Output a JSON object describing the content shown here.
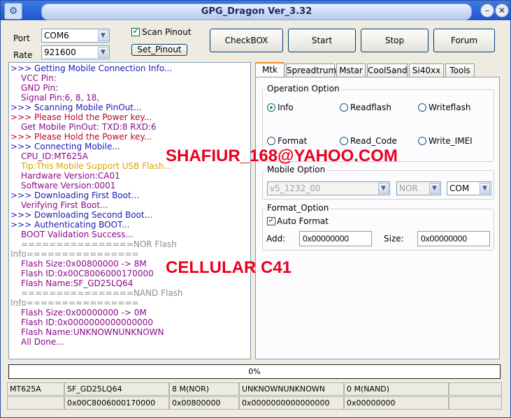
{
  "window": {
    "title": "GPG_Dragon  Ver_3.32",
    "min_glyph": "–",
    "close_glyph": "✕",
    "app_icon_glyph": "⚙"
  },
  "connection": {
    "port_label": "Port",
    "port_value": "COM6",
    "rate_label": "Rate",
    "rate_value": "921600",
    "scan_pinout_label": "Scan Pinout",
    "scan_pinout_checked": true,
    "set_pinout_label": "Set_Pinout"
  },
  "toolbar": {
    "checkbox_label": "CheckBOX",
    "start_label": "Start",
    "stop_label": "Stop",
    "forum_label": "Forum"
  },
  "log": [
    {
      "text": ">>> Getting Mobile Connection Info...",
      "color": "blue",
      "indent": 0
    },
    {
      "text": "VCC Pin:",
      "color": "purple",
      "indent": 1
    },
    {
      "text": "GND Pin:",
      "color": "purple",
      "indent": 1
    },
    {
      "text": "Signal Pin:6, 8, 18,",
      "color": "purple",
      "indent": 1
    },
    {
      "text": ">>> Scanning Mobile PinOut...",
      "color": "blue",
      "indent": 0
    },
    {
      "text": ">>> Please Hold the Power key...",
      "color": "red",
      "indent": 0
    },
    {
      "text": "Get Mobile PinOut: TXD:8  RXD:6",
      "color": "purple",
      "indent": 1
    },
    {
      "text": ">>> Please Hold the Power key...",
      "color": "red",
      "indent": 0
    },
    {
      "text": ">>> Connecting Mobile...",
      "color": "blue",
      "indent": 0
    },
    {
      "text": "CPU_ID:MT625A",
      "color": "purple",
      "indent": 1
    },
    {
      "text": "Tip:This Mobile Support USB Flash...",
      "color": "yellow",
      "indent": 1
    },
    {
      "text": "Hardware Version:CA01",
      "color": "purple",
      "indent": 1
    },
    {
      "text": "Software Version:0001",
      "color": "purple",
      "indent": 1
    },
    {
      "text": ">>> Downloading First Boot...",
      "color": "blue",
      "indent": 0
    },
    {
      "text": "Verifying First Boot...",
      "color": "purple",
      "indent": 1
    },
    {
      "text": ">>> Downloading Second Boot...",
      "color": "blue",
      "indent": 0
    },
    {
      "text": ">>> Authenticating BOOT...",
      "color": "blue",
      "indent": 0
    },
    {
      "text": "BOOT Validation Success...",
      "color": "purple",
      "indent": 1
    },
    {
      "text": "================NOR Flash",
      "color": "gray",
      "indent": 1
    },
    {
      "text": "Info================",
      "color": "gray",
      "indent": 0
    },
    {
      "text": "Flash Size:0x00800000 -> 8M",
      "color": "purple",
      "indent": 1
    },
    {
      "text": "Flash ID:0x00C8006000170000",
      "color": "purple",
      "indent": 1
    },
    {
      "text": "Flash Name:SF_GD25LQ64",
      "color": "purple",
      "indent": 1
    },
    {
      "text": "================NAND Flash",
      "color": "gray",
      "indent": 1
    },
    {
      "text": "Info================",
      "color": "gray",
      "indent": 0
    },
    {
      "text": "Flash Size:0x00000000 -> 0M",
      "color": "purple",
      "indent": 1
    },
    {
      "text": "Flash ID:0x0000000000000000",
      "color": "purple",
      "indent": 1
    },
    {
      "text": "Flash Name:UNKNOWNUNKNOWN",
      "color": "purple",
      "indent": 1
    },
    {
      "text": "All Done...",
      "color": "purple",
      "indent": 1
    }
  ],
  "tabs": [
    "Mtk",
    "Spreadtrum",
    "Mstar",
    "CoolSand",
    "Si40xx",
    "Tools"
  ],
  "active_tab": "Mtk",
  "operation": {
    "title": "Operation Option",
    "options": [
      "Info",
      "Readflash",
      "Writeflash",
      "Format",
      "Read_Code",
      "Write_IMEI"
    ],
    "selected": "Info"
  },
  "mobile_option": {
    "title": "Mobile Option",
    "model_value": "v5_1232_00",
    "flash_value": "NOR",
    "port_value": "COM"
  },
  "format_option": {
    "title": "Format_Option",
    "auto_format_label": "Auto Format",
    "auto_format_checked": true,
    "add_label": "Add:",
    "add_value": "0x00000000",
    "size_label": "Size:",
    "size_value": "0x00000000"
  },
  "overlay": {
    "email": "SHAFIUR_168@YAHOO.COM",
    "phone": "CELLULAR C41"
  },
  "progress": {
    "percent": 0,
    "text": "0%"
  },
  "status": {
    "row1": [
      "MT625A",
      "SF_GD25LQ64",
      "8 M(NOR)",
      "UNKNOWNUNKNOWN",
      "0 M(NAND)",
      ""
    ],
    "row2": [
      "",
      "0x00C8006000170000",
      "0x00800000",
      "0x0000000000000000",
      "0x00000000",
      ""
    ]
  },
  "colors": {
    "blue": "#1a1ab4",
    "purple": "#8a0a8a",
    "red": "#c0002a",
    "yellow": "#d4a800",
    "gray": "#8c8c8c",
    "overlay": "#e8001e",
    "progress_fill": "#2ca02c"
  },
  "icons": {
    "dropdown": "chevron-down-icon",
    "check": "checkmark-icon"
  }
}
